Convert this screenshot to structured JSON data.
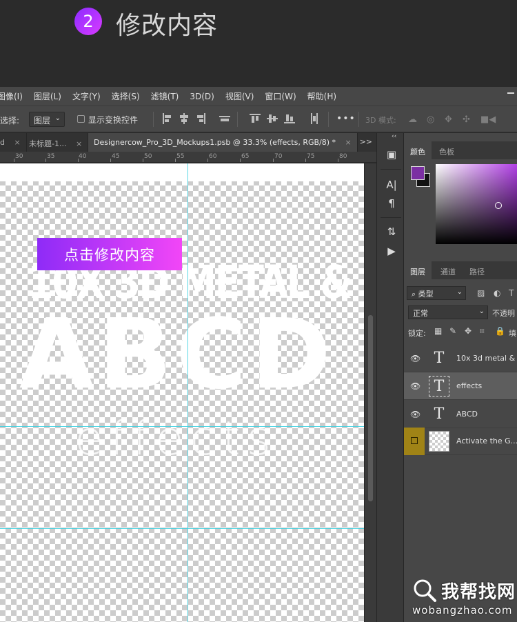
{
  "tutorial": {
    "step_number": "2",
    "title": "修改内容"
  },
  "menu": [
    "图像(I)",
    "图层(L)",
    "文字(Y)",
    "选择(S)",
    "滤镜(T)",
    "3D(D)",
    "视图(V)",
    "窗口(W)",
    "帮助(H)"
  ],
  "options_bar": {
    "select_label": "选择:",
    "select_value": "图层",
    "show_transform_label": "显示变换控件",
    "more_label": "•••",
    "mode3d_label": "3D 模式:"
  },
  "tabs": [
    {
      "label": "d"
    },
    {
      "label": "未标题-1..."
    },
    {
      "label": "Designercow_Pro_3D_Mockups1.psb @ 33.3% (effects, RGB/8) *"
    }
  ],
  "tab_overflow": ">>",
  "ruler": [
    "30",
    "35",
    "40",
    "45",
    "50",
    "55",
    "60",
    "65",
    "70",
    "75",
    "80"
  ],
  "canvas": {
    "line1": "10X 3D METAL &",
    "line2": "ABCD",
    "line3": "effects",
    "button": "点击修改内容"
  },
  "color_panel": {
    "tabs": [
      "颜色",
      "色板"
    ],
    "fg": "#7b2fa2",
    "bg": "#111111"
  },
  "layers_panel": {
    "tabs": [
      "图层",
      "通道",
      "路径"
    ],
    "filter_label": "类型",
    "blend_mode": "正常",
    "opacity_label": "不透明",
    "lock_label": "锁定:",
    "fill_label": "填",
    "layers": [
      {
        "name": "10x 3d metal &",
        "type": "text"
      },
      {
        "name": "effects",
        "type": "text"
      },
      {
        "name": "ABCD",
        "type": "text"
      },
      {
        "name": "Activate the G...s!",
        "type": "image"
      }
    ]
  },
  "watermark": {
    "name": "我帮找网",
    "url": "wobangzhao.com"
  },
  "colors": {
    "accent_start": "#8e2bf7",
    "accent_end": "#f246f7",
    "guide": "#38d0e0"
  }
}
